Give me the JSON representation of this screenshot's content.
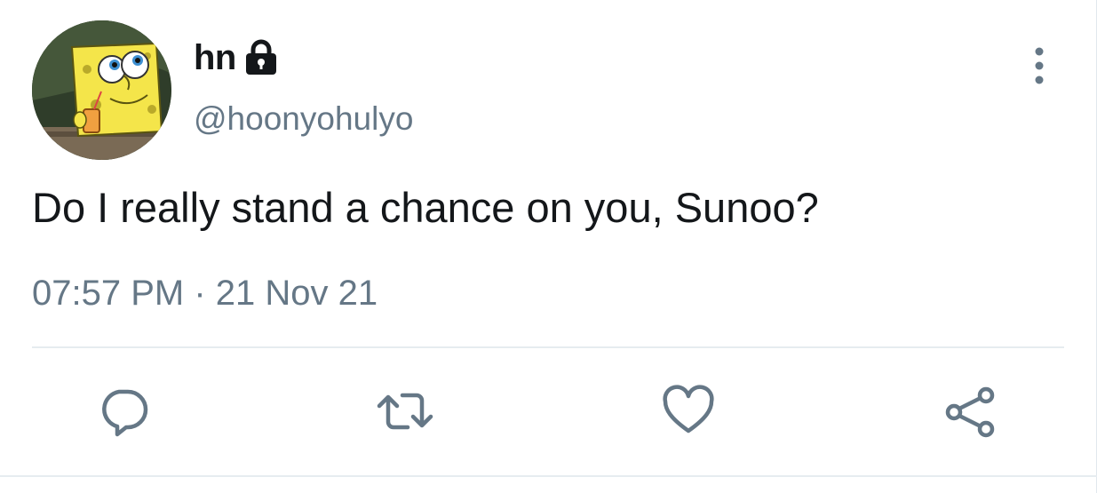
{
  "user": {
    "display_name": "hn",
    "handle": "@hoonyohulyo",
    "protected": true,
    "avatar_icon": "avatar-cartoon"
  },
  "tweet": {
    "text": "Do I really stand a chance on you, Sunoo?",
    "timestamp": "07:57 PM · 21 Nov 21"
  },
  "actions": {
    "reply_icon": "reply-icon",
    "retweet_icon": "retweet-icon",
    "like_icon": "heart-icon",
    "share_icon": "share-icon"
  },
  "colors": {
    "text_primary": "#14171a",
    "text_secondary": "#657786",
    "icon": "#657786",
    "divider": "#e6ecf0"
  }
}
